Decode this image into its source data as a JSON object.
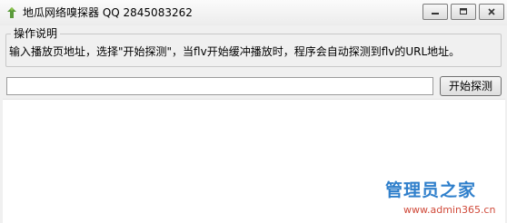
{
  "window": {
    "title": "地瓜网络嗅探器 QQ 2845083262"
  },
  "instructions": {
    "legend": "操作说明",
    "text": "输入播放页地址，选择\"开始探测\"，当flv开始缓冲播放时，程序会自动探测到flv的URL地址。"
  },
  "url_input": {
    "value": "",
    "placeholder": ""
  },
  "start_button": {
    "label": "开始探测"
  },
  "watermark": {
    "title": "管理员之家",
    "url": "www.admin365.cn"
  },
  "icons": {
    "app": "sweet-potato-app-icon",
    "minimize": "minimize-icon",
    "maximize": "maximize-icon",
    "close": "close-icon"
  }
}
